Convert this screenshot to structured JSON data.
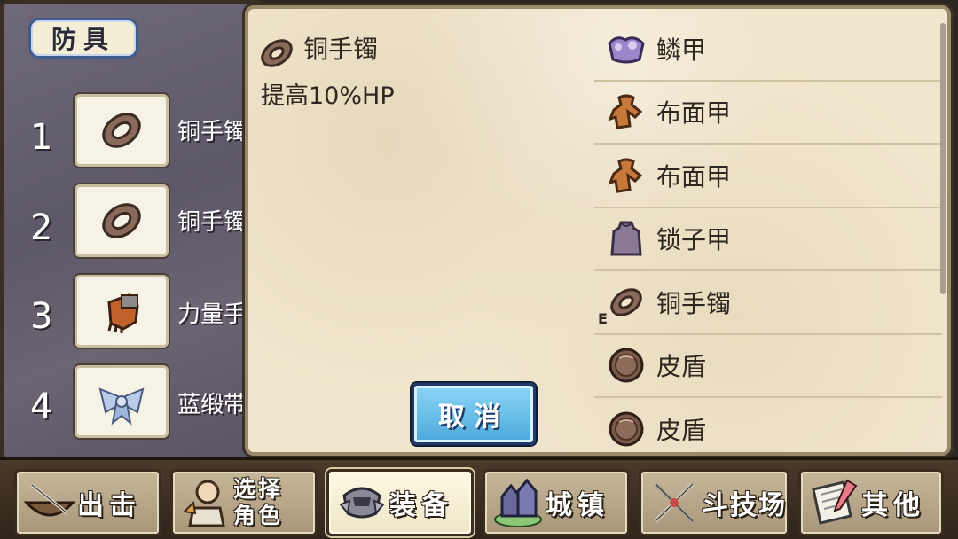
{
  "left_panel": {
    "title": "防具",
    "slots": [
      {
        "num": "1",
        "label": "铜手镯",
        "icon": "copper-bracelet-icon"
      },
      {
        "num": "2",
        "label": "铜手镯",
        "icon": "copper-bracelet-icon"
      },
      {
        "num": "3",
        "label": "力量手套",
        "icon": "power-gloves-icon"
      },
      {
        "num": "4",
        "label": "蓝缎带",
        "icon": "blue-ribbon-icon"
      }
    ]
  },
  "detail": {
    "name": "铜手镯",
    "description": "提高10%HP",
    "icon": "copper-bracelet-icon"
  },
  "cancel_label": "取消",
  "item_list": [
    {
      "label": "鳞甲",
      "icon": "scale-armor-icon"
    },
    {
      "label": "布面甲",
      "icon": "cloth-armor-icon"
    },
    {
      "label": "布面甲",
      "icon": "cloth-armor-icon"
    },
    {
      "label": "锁子甲",
      "icon": "chainmail-icon"
    },
    {
      "label": "铜手镯",
      "icon": "copper-bracelet-icon",
      "equipped_mark": "E"
    },
    {
      "label": "皮盾",
      "icon": "leather-shield-icon"
    },
    {
      "label": "皮盾",
      "icon": "leather-shield-icon"
    }
  ],
  "nav": [
    {
      "label": "出击",
      "icon": "sortie-icon"
    },
    {
      "label_line1": "选择",
      "label_line2": "角色",
      "icon": "select-character-icon"
    },
    {
      "label": "装备",
      "icon": "equipment-icon",
      "active": true
    },
    {
      "label": "城镇",
      "icon": "town-icon"
    },
    {
      "label": "斗技场",
      "icon": "arena-icon"
    },
    {
      "label": "其他",
      "icon": "other-icon"
    }
  ],
  "colors": {
    "parchment": "#f0e6cd",
    "cancel_button": "#5ab4e2",
    "panel_left": "#655f70",
    "text_dark": "#2e2720"
  }
}
